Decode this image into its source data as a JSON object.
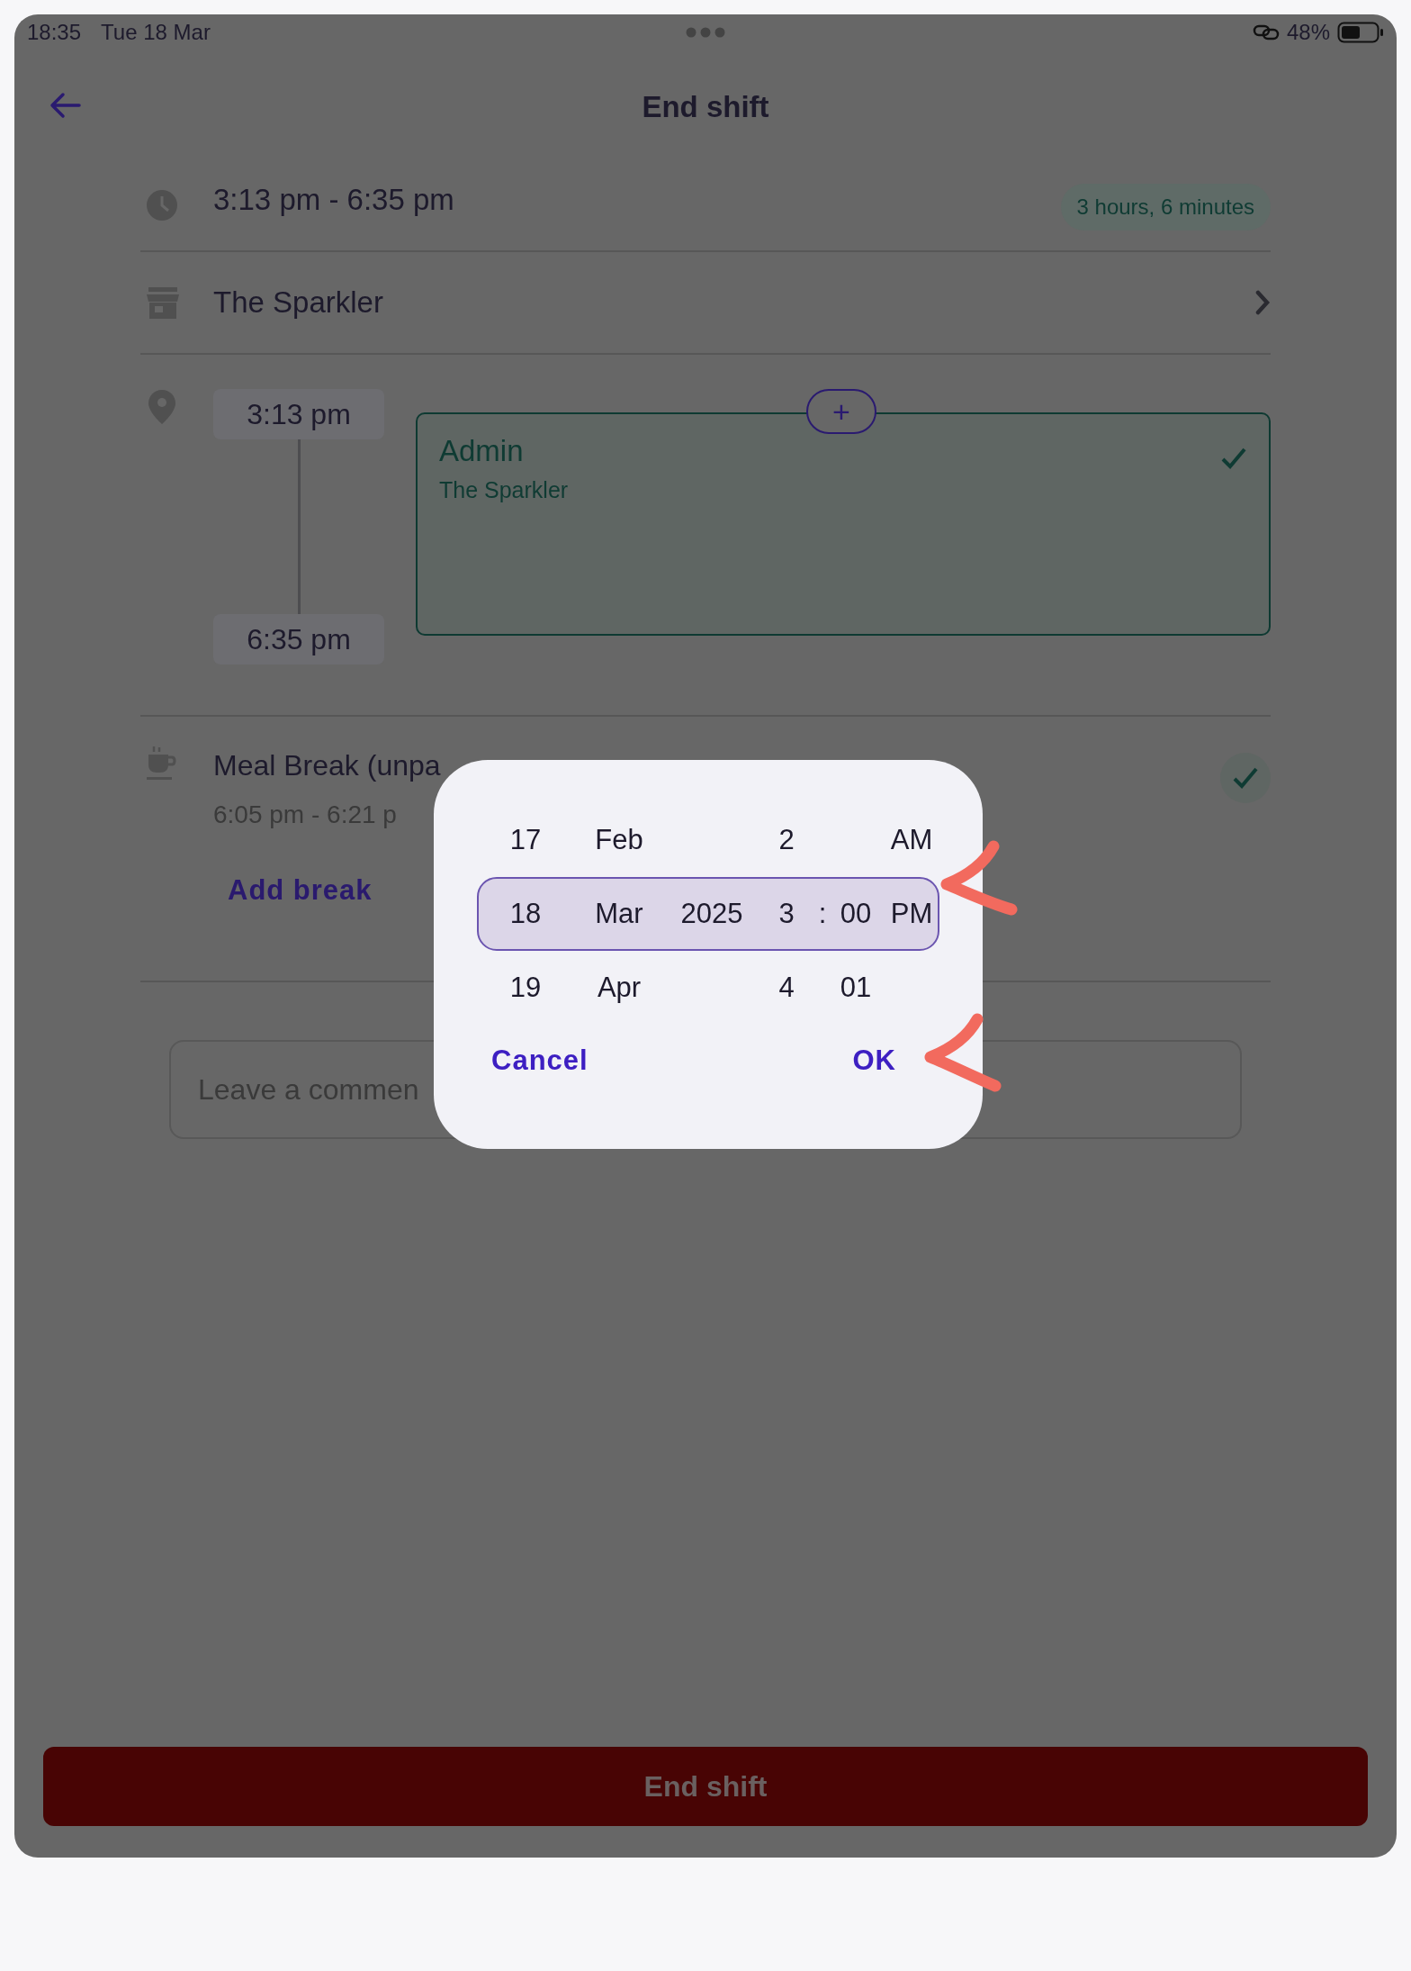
{
  "status_bar": {
    "time": "18:35",
    "date": "Tue 18 Mar",
    "battery": "48%"
  },
  "header": {
    "title": "End shift"
  },
  "shift": {
    "range": "3:13 pm - 6:35 pm",
    "duration": "3 hours, 6 minutes"
  },
  "location": {
    "name": "The Sparkler"
  },
  "timeline": {
    "start": "3:13 pm",
    "end": "6:35 pm",
    "add": "+",
    "card": {
      "role": "Admin",
      "place": "The Sparkler",
      "checked": true
    }
  },
  "break": {
    "title": "Meal Break (unpa",
    "time": "6:05 pm - 6:21 p",
    "checked": true,
    "add_label": "Add break"
  },
  "comment": {
    "placeholder": "Leave a commen"
  },
  "footer": {
    "button": "End shift"
  },
  "picker": {
    "rows": [
      {
        "selected": false,
        "day": "17",
        "month": "Feb",
        "hour": "2",
        "period": "AM"
      },
      {
        "selected": true,
        "day": "18",
        "month": "Mar",
        "year": "2025",
        "hour": "3",
        "separator": ":",
        "minute": "00",
        "period": "PM"
      },
      {
        "selected": false,
        "day": "19",
        "month": "Apr",
        "hour": "4",
        "minute": "01"
      }
    ],
    "cancel": "Cancel",
    "ok": "OK"
  }
}
